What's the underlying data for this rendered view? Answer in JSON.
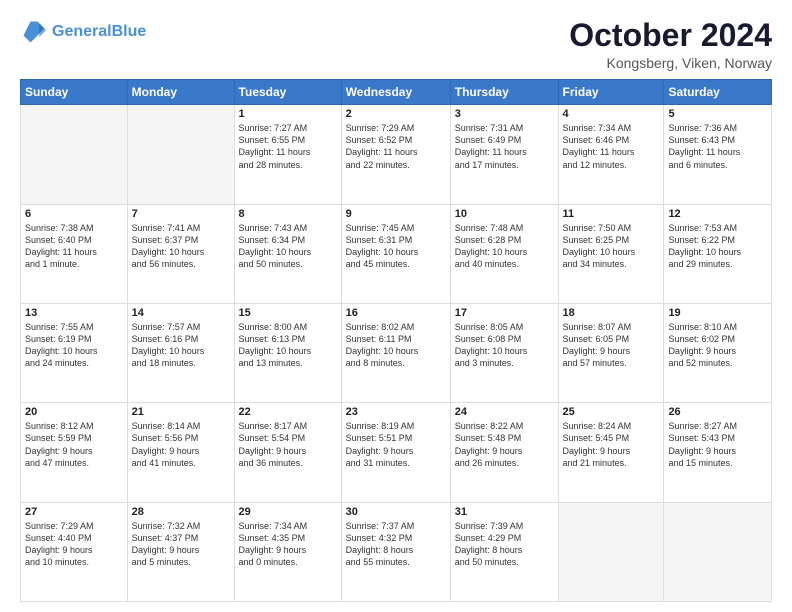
{
  "header": {
    "logo_line1": "General",
    "logo_line2": "Blue",
    "title": "October 2024",
    "location": "Kongsberg, Viken, Norway"
  },
  "weekdays": [
    "Sunday",
    "Monday",
    "Tuesday",
    "Wednesday",
    "Thursday",
    "Friday",
    "Saturday"
  ],
  "weeks": [
    [
      {
        "day": "",
        "text": ""
      },
      {
        "day": "",
        "text": ""
      },
      {
        "day": "1",
        "text": "Sunrise: 7:27 AM\nSunset: 6:55 PM\nDaylight: 11 hours\nand 28 minutes."
      },
      {
        "day": "2",
        "text": "Sunrise: 7:29 AM\nSunset: 6:52 PM\nDaylight: 11 hours\nand 22 minutes."
      },
      {
        "day": "3",
        "text": "Sunrise: 7:31 AM\nSunset: 6:49 PM\nDaylight: 11 hours\nand 17 minutes."
      },
      {
        "day": "4",
        "text": "Sunrise: 7:34 AM\nSunset: 6:46 PM\nDaylight: 11 hours\nand 12 minutes."
      },
      {
        "day": "5",
        "text": "Sunrise: 7:36 AM\nSunset: 6:43 PM\nDaylight: 11 hours\nand 6 minutes."
      }
    ],
    [
      {
        "day": "6",
        "text": "Sunrise: 7:38 AM\nSunset: 6:40 PM\nDaylight: 11 hours\nand 1 minute."
      },
      {
        "day": "7",
        "text": "Sunrise: 7:41 AM\nSunset: 6:37 PM\nDaylight: 10 hours\nand 56 minutes."
      },
      {
        "day": "8",
        "text": "Sunrise: 7:43 AM\nSunset: 6:34 PM\nDaylight: 10 hours\nand 50 minutes."
      },
      {
        "day": "9",
        "text": "Sunrise: 7:45 AM\nSunset: 6:31 PM\nDaylight: 10 hours\nand 45 minutes."
      },
      {
        "day": "10",
        "text": "Sunrise: 7:48 AM\nSunset: 6:28 PM\nDaylight: 10 hours\nand 40 minutes."
      },
      {
        "day": "11",
        "text": "Sunrise: 7:50 AM\nSunset: 6:25 PM\nDaylight: 10 hours\nand 34 minutes."
      },
      {
        "day": "12",
        "text": "Sunrise: 7:53 AM\nSunset: 6:22 PM\nDaylight: 10 hours\nand 29 minutes."
      }
    ],
    [
      {
        "day": "13",
        "text": "Sunrise: 7:55 AM\nSunset: 6:19 PM\nDaylight: 10 hours\nand 24 minutes."
      },
      {
        "day": "14",
        "text": "Sunrise: 7:57 AM\nSunset: 6:16 PM\nDaylight: 10 hours\nand 18 minutes."
      },
      {
        "day": "15",
        "text": "Sunrise: 8:00 AM\nSunset: 6:13 PM\nDaylight: 10 hours\nand 13 minutes."
      },
      {
        "day": "16",
        "text": "Sunrise: 8:02 AM\nSunset: 6:11 PM\nDaylight: 10 hours\nand 8 minutes."
      },
      {
        "day": "17",
        "text": "Sunrise: 8:05 AM\nSunset: 6:08 PM\nDaylight: 10 hours\nand 3 minutes."
      },
      {
        "day": "18",
        "text": "Sunrise: 8:07 AM\nSunset: 6:05 PM\nDaylight: 9 hours\nand 57 minutes."
      },
      {
        "day": "19",
        "text": "Sunrise: 8:10 AM\nSunset: 6:02 PM\nDaylight: 9 hours\nand 52 minutes."
      }
    ],
    [
      {
        "day": "20",
        "text": "Sunrise: 8:12 AM\nSunset: 5:59 PM\nDaylight: 9 hours\nand 47 minutes."
      },
      {
        "day": "21",
        "text": "Sunrise: 8:14 AM\nSunset: 5:56 PM\nDaylight: 9 hours\nand 41 minutes."
      },
      {
        "day": "22",
        "text": "Sunrise: 8:17 AM\nSunset: 5:54 PM\nDaylight: 9 hours\nand 36 minutes."
      },
      {
        "day": "23",
        "text": "Sunrise: 8:19 AM\nSunset: 5:51 PM\nDaylight: 9 hours\nand 31 minutes."
      },
      {
        "day": "24",
        "text": "Sunrise: 8:22 AM\nSunset: 5:48 PM\nDaylight: 9 hours\nand 26 minutes."
      },
      {
        "day": "25",
        "text": "Sunrise: 8:24 AM\nSunset: 5:45 PM\nDaylight: 9 hours\nand 21 minutes."
      },
      {
        "day": "26",
        "text": "Sunrise: 8:27 AM\nSunset: 5:43 PM\nDaylight: 9 hours\nand 15 minutes."
      }
    ],
    [
      {
        "day": "27",
        "text": "Sunrise: 7:29 AM\nSunset: 4:40 PM\nDaylight: 9 hours\nand 10 minutes."
      },
      {
        "day": "28",
        "text": "Sunrise: 7:32 AM\nSunset: 4:37 PM\nDaylight: 9 hours\nand 5 minutes."
      },
      {
        "day": "29",
        "text": "Sunrise: 7:34 AM\nSunset: 4:35 PM\nDaylight: 9 hours\nand 0 minutes."
      },
      {
        "day": "30",
        "text": "Sunrise: 7:37 AM\nSunset: 4:32 PM\nDaylight: 8 hours\nand 55 minutes."
      },
      {
        "day": "31",
        "text": "Sunrise: 7:39 AM\nSunset: 4:29 PM\nDaylight: 8 hours\nand 50 minutes."
      },
      {
        "day": "",
        "text": ""
      },
      {
        "day": "",
        "text": ""
      }
    ]
  ]
}
